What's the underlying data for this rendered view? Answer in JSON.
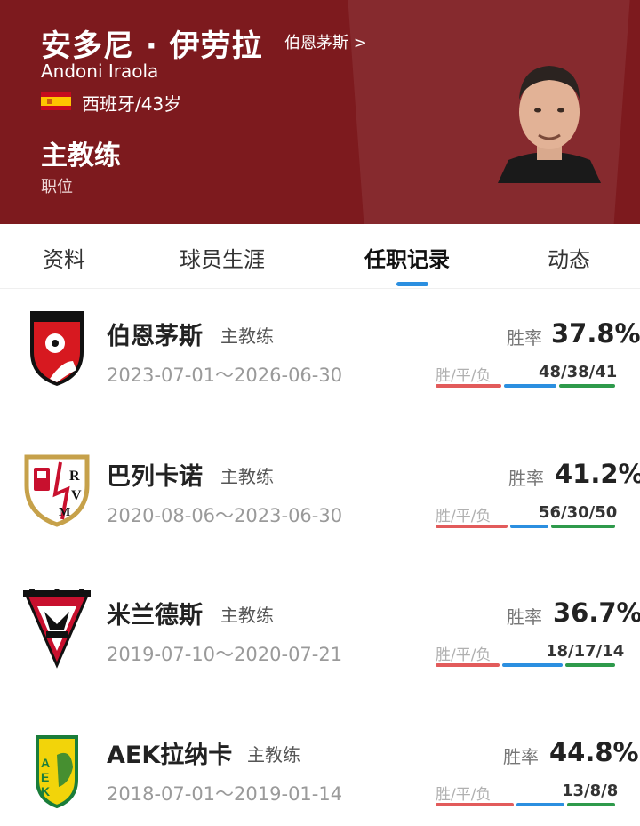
{
  "colors": {
    "header_bg": "#7d1a1e",
    "accent": "#2b8fe0",
    "win": "#e25b5b",
    "draw": "#2b8fe0",
    "loss": "#2e9a4b"
  },
  "profile": {
    "name_cn": "安多尼 · 伊劳拉",
    "club_link": "伯恩茅斯 >",
    "name_en": "Andoni Iraola",
    "flag_icon": "spain-flag-icon",
    "nationality_age": "西班牙/43岁",
    "role": "主教练",
    "role_label": "职位"
  },
  "tabs": [
    {
      "label": "资料",
      "active": false
    },
    {
      "label": "球员生涯",
      "active": false
    },
    {
      "label": "任职记录",
      "active": true
    },
    {
      "label": "动态",
      "active": false
    }
  ],
  "records": [
    {
      "club": "伯恩茅斯",
      "role": "主教练",
      "dates": "2023-07-01～2026-06-30",
      "win_rate_label": "胜率",
      "win_rate": "37.8%",
      "wdl_label": "胜/平/负",
      "wdl": "48/38/41",
      "w": 48,
      "d": 38,
      "l": 41,
      "logo_icon": "bournemouth-logo-icon"
    },
    {
      "club": "巴列卡诺",
      "role": "主教练",
      "dates": "2020-08-06～2023-06-30",
      "win_rate_label": "胜率",
      "win_rate": "41.2%",
      "wdl_label": "胜/平/负",
      "wdl": "56/30/50",
      "w": 56,
      "d": 30,
      "l": 50,
      "logo_icon": "rayo-vallecano-logo-icon"
    },
    {
      "club": "米兰德斯",
      "role": "主教练",
      "dates": "2019-07-10～2020-07-21",
      "win_rate_label": "胜率",
      "win_rate": "36.7%",
      "wdl_label": "胜/平/负",
      "wdl": "18/17/14",
      "w": 18,
      "d": 17,
      "l": 14,
      "logo_icon": "mirandes-logo-icon"
    },
    {
      "club": "AEK拉纳卡",
      "role": "主教练",
      "dates": "2018-07-01～2019-01-14",
      "win_rate_label": "胜率",
      "win_rate": "44.8%",
      "wdl_label": "胜/平/负",
      "wdl": "13/8/8",
      "w": 13,
      "d": 8,
      "l": 8,
      "logo_icon": "aek-larnaca-logo-icon"
    }
  ]
}
